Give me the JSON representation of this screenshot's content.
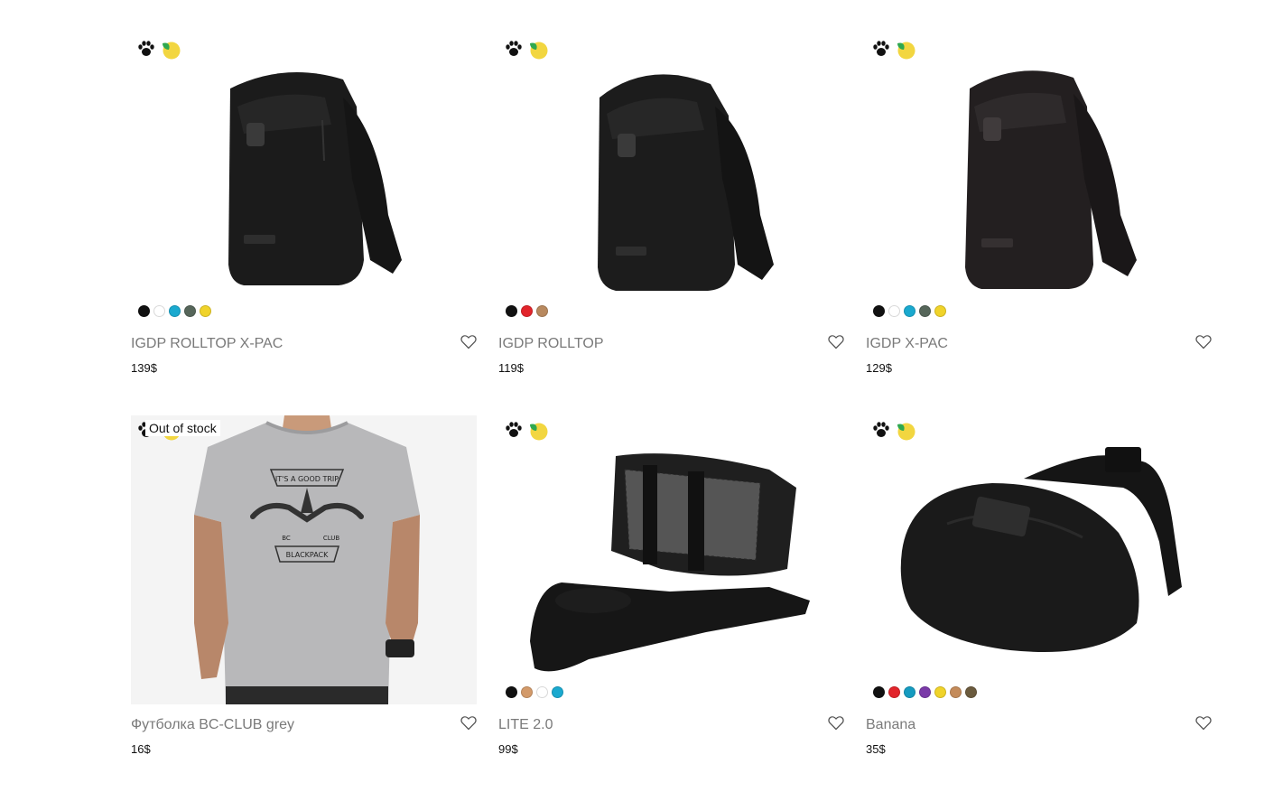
{
  "products": [
    {
      "name": "IGDP ROLLTOP X-PAC",
      "price": "139$",
      "swatches": [
        "#111111",
        "#ffffff",
        "#1aa9cf",
        "#56665a",
        "#f0d32a"
      ]
    },
    {
      "name": "IGDP ROLLTOP",
      "price": "119$",
      "swatches": [
        "#111111",
        "#e2242b",
        "#b8895f"
      ]
    },
    {
      "name": "IGDP X-PAC",
      "price": "129$",
      "swatches": [
        "#111111",
        "#ffffff",
        "#1aa9cf",
        "#56665a",
        "#f0d32a"
      ]
    },
    {
      "name": "Футболка BC-CLUB grey",
      "price": "16$",
      "status": "Out of stock",
      "swatches": []
    },
    {
      "name": "LITE 2.0",
      "price": "99$",
      "swatches": [
        "#111111",
        "#d39a6a",
        "#ffffff",
        "#1aa9cf"
      ]
    },
    {
      "name": "Banana",
      "price": "35$",
      "swatches": [
        "#111111",
        "#e2242b",
        "#159bc0",
        "#7a3aa8",
        "#f0d32a",
        "#c48b5a",
        "#6b5b3e"
      ]
    }
  ],
  "tshirt_print": {
    "top": "IT'S A GOOD TRIP",
    "left": "BC",
    "right": "CLUB",
    "bottom": "BLACKPACK"
  }
}
